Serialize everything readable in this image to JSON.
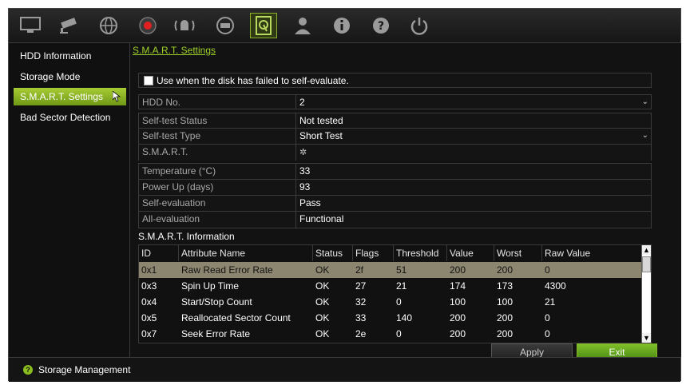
{
  "toolbar": {
    "icons": [
      "monitor-icon",
      "camera-icon",
      "network-icon",
      "record-icon",
      "alarm-icon",
      "device-icon",
      "storage-icon",
      "user-icon",
      "info-icon",
      "help-icon",
      "power-icon"
    ]
  },
  "sidebar": {
    "items": [
      {
        "label": "HDD Information"
      },
      {
        "label": "Storage Mode"
      },
      {
        "label": "S.M.A.R.T. Settings"
      },
      {
        "label": "Bad Sector Detection"
      }
    ]
  },
  "main": {
    "breadcrumb": "S.M.A.R.T. Settings",
    "checkbox_label": "Use when the disk has failed to self-evaluate.",
    "hdd_no": {
      "label": "HDD No.",
      "value": "2"
    },
    "self_test_status": {
      "label": "Self-test Status",
      "value": "Not tested"
    },
    "self_test_type": {
      "label": "Self-test Type",
      "value": "Short Test"
    },
    "smart": {
      "label": "S.M.A.R.T."
    },
    "temperature": {
      "label": "Temperature (°C)",
      "value": "33"
    },
    "power_up": {
      "label": "Power Up (days)",
      "value": "93"
    },
    "self_evaluation": {
      "label": "Self-evaluation",
      "value": "Pass"
    },
    "all_evaluation": {
      "label": "All-evaluation",
      "value": "Functional"
    },
    "info_title": "S.M.A.R.T. Information",
    "table": {
      "headers": [
        "ID",
        "Attribute Name",
        "Status",
        "Flags",
        "Threshold",
        "Value",
        "Worst",
        "Raw Value"
      ],
      "rows": [
        [
          "0x1",
          "Raw Read Error Rate",
          "OK",
          "2f",
          "51",
          "200",
          "200",
          "0"
        ],
        [
          "0x3",
          "Spin Up Time",
          "OK",
          "27",
          "21",
          "174",
          "173",
          "4300"
        ],
        [
          "0x4",
          "Start/Stop Count",
          "OK",
          "32",
          "0",
          "100",
          "100",
          "21"
        ],
        [
          "0x5",
          "Reallocated Sector Count",
          "OK",
          "33",
          "140",
          "200",
          "200",
          "0"
        ],
        [
          "0x7",
          "Seek Error Rate",
          "OK",
          "2e",
          "0",
          "200",
          "200",
          "0"
        ]
      ]
    },
    "apply_label": "Apply",
    "exit_label": "Exit"
  },
  "status_bar": {
    "text": "Storage Management"
  },
  "colors": {
    "accent": "#8cbd1e",
    "background": "#121212"
  }
}
